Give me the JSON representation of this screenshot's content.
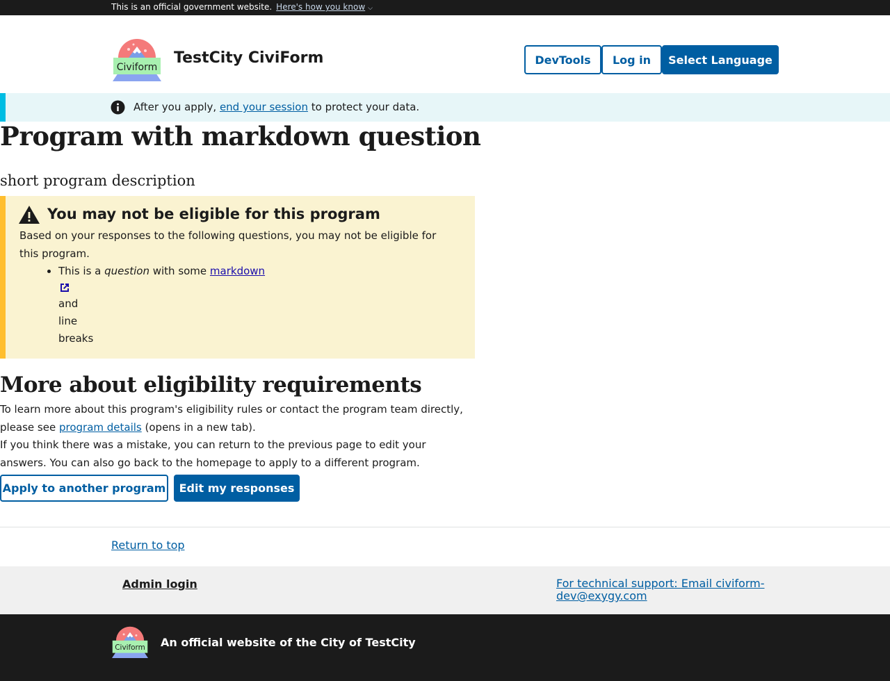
{
  "gov_banner": {
    "text": "This is an official government website.",
    "link": "Here's how you know"
  },
  "header": {
    "logo_text": "Civiform",
    "title": "TestCity CiviForm",
    "buttons": {
      "devtools": "DevTools",
      "login": "Log in",
      "language": "Select Language"
    }
  },
  "session_alert": {
    "before": "After you apply, ",
    "link": "end your session",
    "after": " to protect your data."
  },
  "main": {
    "title": "Program with markdown question",
    "description": "short program description",
    "eligibility_alert": {
      "heading": "You may not be eligible for this program",
      "body": "Based on your responses to the following questions, you may not be eligible for this program.",
      "question": {
        "prefix": "This is a ",
        "emphasis": "question",
        "middle": " with some ",
        "link": "markdown",
        "lines": [
          "and",
          "line",
          "breaks"
        ]
      }
    },
    "more_heading": "More about eligibility requirements",
    "para1": {
      "before": "To learn more about this program's eligibility rules or contact the program team directly, please see ",
      "link": "program details",
      "after": " (opens in a new tab)."
    },
    "para2": "If you think there was a mistake, you can return to the previous page to edit your answers. You can also go back to the homepage to apply to a different program.",
    "buttons": {
      "apply_another": "Apply to another program",
      "edit": "Edit my responses"
    }
  },
  "return_to_top": "Return to top",
  "footer": {
    "admin_login": "Admin login",
    "support": "For technical support: Email civiform-dev@exygy.com",
    "logo_text": "Civiform",
    "official": "An official website of the City of TestCity"
  },
  "colors": {
    "primary": "#005ea2",
    "info_bg": "#e7f6f8",
    "info_border": "#00bde3",
    "warning_bg": "#faf3d1",
    "warning_border": "#ffbe2e",
    "dark": "#1b1b1b"
  }
}
